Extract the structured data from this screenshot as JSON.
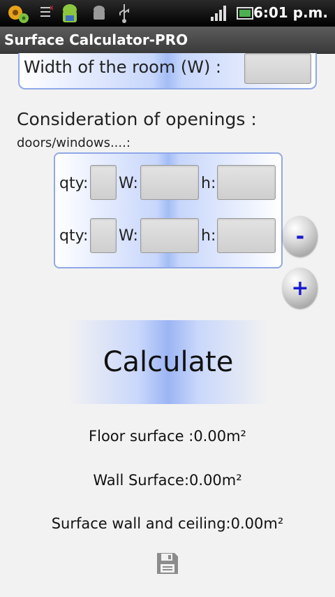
{
  "status_bar": {
    "time": "6:01 p.m.",
    "icons": [
      "gear-notification-icon",
      "tasks-icon",
      "android-icon",
      "android-debug-icon",
      "usb-icon",
      "signal-icon",
      "battery-icon"
    ]
  },
  "app": {
    "title": "Surface Calculator-PRO"
  },
  "width_field": {
    "label": "Width of the room (W) :",
    "value": ""
  },
  "openings": {
    "heading": "Consideration of openings :",
    "subheading": "doors/windows....:",
    "rows": [
      {
        "qty_label": "qty:",
        "w_label": "W:",
        "h_label": "h:",
        "qty": "",
        "w": "",
        "h": ""
      },
      {
        "qty_label": "qty:",
        "w_label": "W:",
        "h_label": "h:",
        "qty": "",
        "w": "",
        "h": ""
      }
    ],
    "remove_label": "-",
    "add_label": "+"
  },
  "calculate_label": "Calculate",
  "results": {
    "floor": "Floor surface :0.00m²",
    "wall": "Wall Surface:0.00m²",
    "wall_ceiling": "Surface wall and ceiling:0.00m²"
  },
  "colors": {
    "accent": "#1a1ad0",
    "panel_border": "#8fa8e8"
  }
}
